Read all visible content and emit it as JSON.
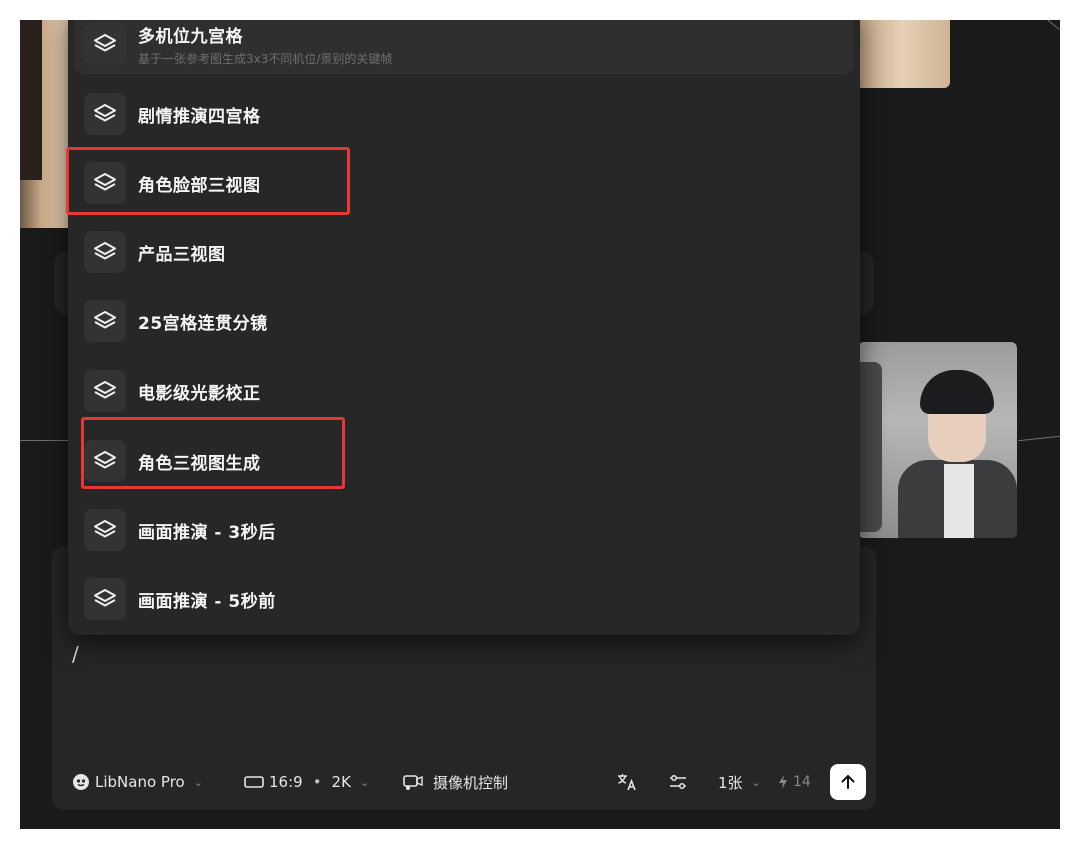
{
  "menu": {
    "items": [
      {
        "label": "多机位九宫格",
        "desc": "基于一张参考图生成3x3不同机位/景别的关键帧",
        "icon": "layers-icon"
      },
      {
        "label": "剧情推演四宫格",
        "icon": "layers-icon"
      },
      {
        "label": "角色脸部三视图",
        "icon": "layers-icon"
      },
      {
        "label": "产品三视图",
        "icon": "layers-icon"
      },
      {
        "label": "25宫格连贯分镜",
        "icon": "layers-icon"
      },
      {
        "label": "电影级光影校正",
        "icon": "layers-icon"
      },
      {
        "label": "角色三视图生成",
        "icon": "layers-icon"
      },
      {
        "label": "画面推演 - 3秒后",
        "icon": "layers-icon"
      },
      {
        "label": "画面推演 - 5秒前",
        "icon": "layers-icon"
      }
    ]
  },
  "input": {
    "value": "/"
  },
  "toolbar": {
    "model": "LibNano Pro",
    "ratio": "16:9",
    "resolution": "2K",
    "camera": "摄像机控制",
    "count": "1张",
    "credits": "14"
  },
  "colors": {
    "highlight": "#e53935",
    "panel": "#262626",
    "dropdown": "#272727",
    "canvas": "#1a1a1a"
  }
}
